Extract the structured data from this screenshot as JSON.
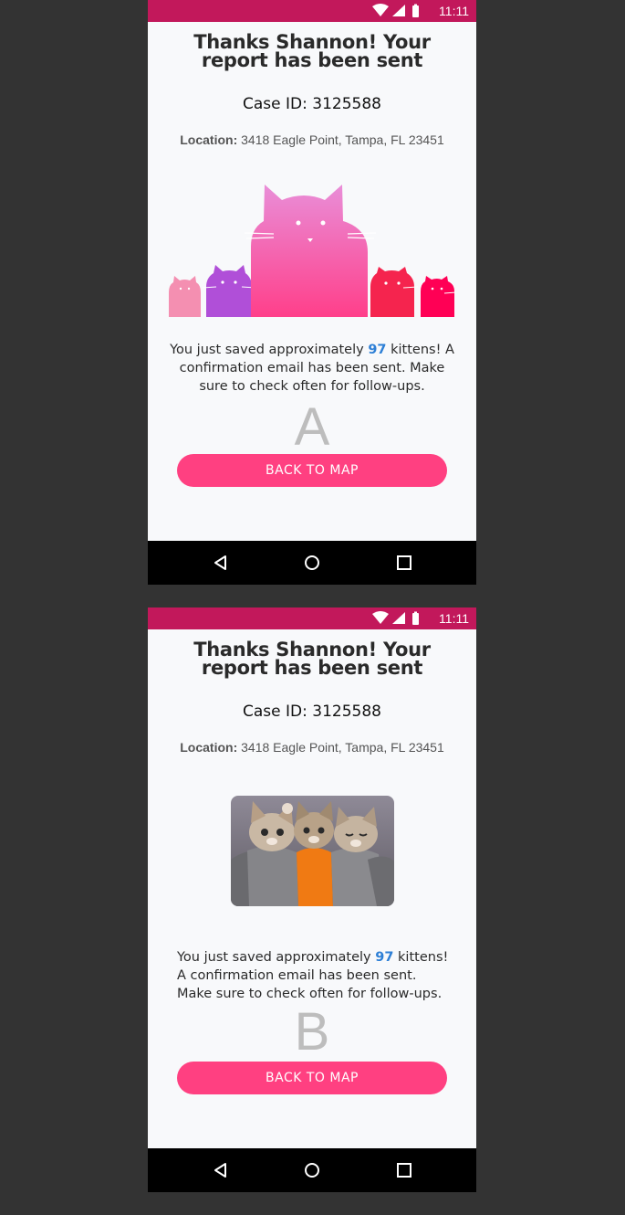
{
  "variants": [
    {
      "status_time": "11:11",
      "title": "Thanks Shannon! Your report has been sent",
      "case_id": "Case ID: 3125588",
      "location_label": "Location:",
      "location_value": "3418 Eagle Point, Tampa, FL 23451",
      "message_pre": "You just saved approximately ",
      "message_count": "97",
      "message_post": " kittens! A confirmation email has been sent. Make sure to check often for follow-ups.",
      "variant_label": "A",
      "button_label": "BACK TO MAP"
    },
    {
      "status_time": "11:11",
      "title": "Thanks Shannon! Your report has been sent",
      "case_id": "Case ID: 3125588",
      "location_label": "Location:",
      "location_value": "3418 Eagle Point, Tampa, FL 23451",
      "message_pre": "You just saved approximately ",
      "message_count": "97",
      "message_post": " kittens! A confirmation email has been sent. Make sure to check often for follow-ups.",
      "variant_label": "B",
      "button_label": "BACK TO MAP"
    }
  ],
  "icons": {
    "status": [
      "wifi-icon",
      "signal-icon",
      "battery-icon"
    ],
    "nav": [
      "back-icon",
      "home-icon",
      "recent-apps-icon"
    ]
  },
  "colors": {
    "status_bar": "#c2185b",
    "button": "#ff4081",
    "highlight": "#2d7fd6",
    "page_background": "#333333"
  }
}
